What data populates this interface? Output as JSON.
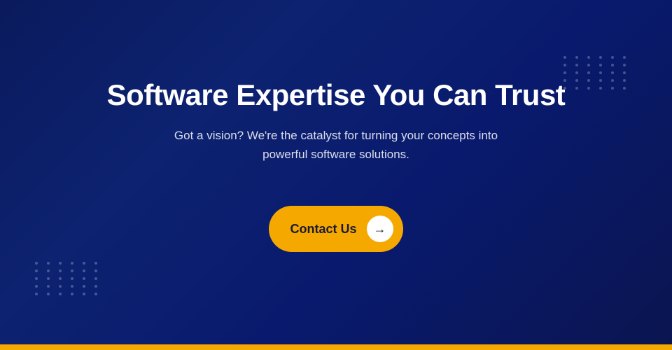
{
  "hero": {
    "title": "Software Expertise You Can Trust",
    "subtitle": "Got a vision? We're the catalyst for turning your concepts into powerful software solutions.",
    "cta_label": "Contact Us",
    "arrow_symbol": "→"
  },
  "colors": {
    "background_start": "#0a1a5c",
    "background_end": "#0a1550",
    "gold": "#f5a800",
    "text_white": "#ffffff",
    "text_dark": "#1a1a2e"
  },
  "dots": {
    "count": 30
  }
}
